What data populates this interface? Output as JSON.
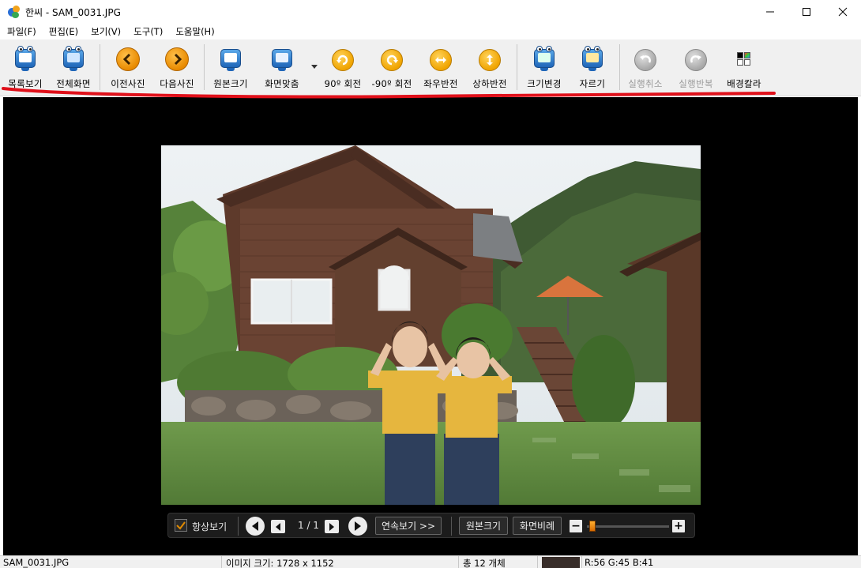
{
  "window": {
    "title": "한씨 - SAM_0031.JPG"
  },
  "menu": [
    "파일(F)",
    "편집(E)",
    "보기(V)",
    "도구(T)",
    "도움말(H)"
  ],
  "toolbar": {
    "list_view": "목록보기",
    "fullscreen": "전체화면",
    "prev_photo": "이전사진",
    "next_photo": "다음사진",
    "original_size": "원본크기",
    "fit_screen": "화면맞춤",
    "rotate_cw": "90º 회전",
    "rotate_ccw": "-90º 회전",
    "flip_h": "좌우반전",
    "flip_v": "상하반전",
    "resize": "크기변경",
    "crop": "자르기",
    "undo": "실행취소",
    "redo": "실행반복",
    "bg_color": "배경칼라"
  },
  "controls": {
    "always_show": "항상보기",
    "always_show_checked": true,
    "page": "1 / 1",
    "slideshow": "연속보기 >>",
    "original_size": "원본크기",
    "fit_ratio": "화면비례"
  },
  "status": {
    "filename": "SAM_0031.JPG",
    "image_size": "이미지 크기: 1728 x 1152",
    "total": "총 12 개체",
    "pixel_color": "#382d29",
    "rgb": "R:56 G:45 B:41"
  },
  "colors": {
    "annotation": "#e0101a",
    "viewer_bg": "#000000"
  }
}
